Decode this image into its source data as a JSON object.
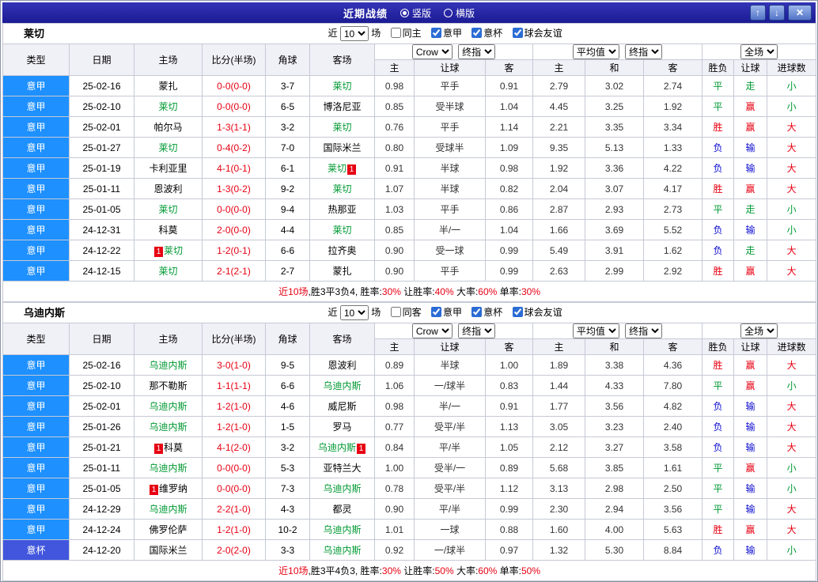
{
  "titlebar": {
    "title": "近期战绩",
    "radios": [
      {
        "label": "竖版",
        "selected": true
      },
      {
        "label": "横版",
        "selected": false
      }
    ],
    "up_icon": "↑",
    "down_icon": "↓",
    "close_icon": "✕"
  },
  "columns": {
    "type": "类型",
    "date": "日期",
    "home": "主场",
    "score": "比分(半场)",
    "corner": "角球",
    "away": "客场",
    "sub": [
      "主",
      "让球",
      "客",
      "主",
      "和",
      "客",
      "胜负",
      "让球",
      "进球数"
    ]
  },
  "selects": {
    "company": "Crow",
    "final": "终指",
    "average": "平均值",
    "scope": "全场"
  },
  "colors": {
    "win": "#e60012",
    "draw": "#009933",
    "lose": "#0b0bd0",
    "focus_team": "#009933",
    "score": "#e60012",
    "serie_a": "#1e90ff",
    "cup": "#4156dd",
    "badge": "#e60012",
    "titlebar_bg": "#1b1b94"
  },
  "badge_text": "1",
  "sections": [
    {
      "team": "莱切",
      "filter": {
        "near": "近",
        "count": "10",
        "unit": "场",
        "same": {
          "label": "同主",
          "checked": false
        },
        "leagues": [
          {
            "label": "意甲",
            "checked": true
          },
          {
            "label": "意杯",
            "checked": true
          },
          {
            "label": "球会友谊",
            "checked": true
          }
        ]
      },
      "rows": [
        {
          "lg": "意甲",
          "lgc": "a",
          "date": "25-02-16",
          "home": {
            "n": "蒙扎"
          },
          "score": "0-0(0-0)",
          "corner": "3-7",
          "away": {
            "n": "莱切",
            "f": 1
          },
          "o": [
            "0.98",
            "平手",
            "0.91"
          ],
          "avg": [
            "2.79",
            "3.02",
            "2.74"
          ],
          "res": [
            "平",
            "g"
          ],
          "hres": [
            "走",
            "g"
          ],
          "gres": [
            "小",
            "g"
          ]
        },
        {
          "lg": "意甲",
          "lgc": "a",
          "date": "25-02-10",
          "home": {
            "n": "莱切",
            "f": 1
          },
          "score": "0-0(0-0)",
          "corner": "6-5",
          "away": {
            "n": "博洛尼亚"
          },
          "o": [
            "0.85",
            "受半球",
            "1.04"
          ],
          "avg": [
            "4.45",
            "3.25",
            "1.92"
          ],
          "res": [
            "平",
            "g"
          ],
          "hres": [
            "赢",
            "r"
          ],
          "gres": [
            "小",
            "g"
          ]
        },
        {
          "lg": "意甲",
          "lgc": "a",
          "date": "25-02-01",
          "home": {
            "n": "帕尔马"
          },
          "score": "1-3(1-1)",
          "corner": "3-2",
          "away": {
            "n": "莱切",
            "f": 1
          },
          "o": [
            "0.76",
            "平手",
            "1.14"
          ],
          "avg": [
            "2.21",
            "3.35",
            "3.34"
          ],
          "res": [
            "胜",
            "r"
          ],
          "hres": [
            "赢",
            "r"
          ],
          "gres": [
            "大",
            "r"
          ]
        },
        {
          "lg": "意甲",
          "lgc": "a",
          "date": "25-01-27",
          "home": {
            "n": "莱切",
            "f": 1
          },
          "score": "0-4(0-2)",
          "corner": "7-0",
          "away": {
            "n": "国际米兰"
          },
          "o": [
            "0.80",
            "受球半",
            "1.09"
          ],
          "avg": [
            "9.35",
            "5.13",
            "1.33"
          ],
          "res": [
            "负",
            "b"
          ],
          "hres": [
            "输",
            "b"
          ],
          "gres": [
            "大",
            "r"
          ]
        },
        {
          "lg": "意甲",
          "lgc": "a",
          "date": "25-01-19",
          "home": {
            "n": "卡利亚里"
          },
          "score": "4-1(0-1)",
          "corner": "6-1",
          "away": {
            "n": "莱切",
            "f": 1,
            "b": "post"
          },
          "o": [
            "0.91",
            "半球",
            "0.98"
          ],
          "avg": [
            "1.92",
            "3.36",
            "4.22"
          ],
          "res": [
            "负",
            "b"
          ],
          "hres": [
            "输",
            "b"
          ],
          "gres": [
            "大",
            "r"
          ]
        },
        {
          "lg": "意甲",
          "lgc": "a",
          "date": "25-01-11",
          "home": {
            "n": "恩波利"
          },
          "score": "1-3(0-2)",
          "corner": "9-2",
          "away": {
            "n": "莱切",
            "f": 1
          },
          "o": [
            "1.07",
            "半球",
            "0.82"
          ],
          "avg": [
            "2.04",
            "3.07",
            "4.17"
          ],
          "res": [
            "胜",
            "r"
          ],
          "hres": [
            "赢",
            "r"
          ],
          "gres": [
            "大",
            "r"
          ]
        },
        {
          "lg": "意甲",
          "lgc": "a",
          "date": "25-01-05",
          "home": {
            "n": "莱切",
            "f": 1
          },
          "score": "0-0(0-0)",
          "corner": "9-4",
          "away": {
            "n": "热那亚"
          },
          "o": [
            "1.03",
            "平手",
            "0.86"
          ],
          "avg": [
            "2.87",
            "2.93",
            "2.73"
          ],
          "res": [
            "平",
            "g"
          ],
          "hres": [
            "走",
            "g"
          ],
          "gres": [
            "小",
            "g"
          ]
        },
        {
          "lg": "意甲",
          "lgc": "a",
          "date": "24-12-31",
          "home": {
            "n": "科莫"
          },
          "score": "2-0(0-0)",
          "corner": "4-4",
          "away": {
            "n": "莱切",
            "f": 1
          },
          "o": [
            "0.85",
            "半/一",
            "1.04"
          ],
          "avg": [
            "1.66",
            "3.69",
            "5.52"
          ],
          "res": [
            "负",
            "b"
          ],
          "hres": [
            "输",
            "b"
          ],
          "gres": [
            "小",
            "g"
          ]
        },
        {
          "lg": "意甲",
          "lgc": "a",
          "date": "24-12-22",
          "home": {
            "n": "莱切",
            "f": 1,
            "b": "pre"
          },
          "score": "1-2(0-1)",
          "corner": "6-6",
          "away": {
            "n": "拉齐奥"
          },
          "o": [
            "0.90",
            "受一球",
            "0.99"
          ],
          "avg": [
            "5.49",
            "3.91",
            "1.62"
          ],
          "res": [
            "负",
            "b"
          ],
          "hres": [
            "走",
            "g"
          ],
          "gres": [
            "大",
            "r"
          ]
        },
        {
          "lg": "意甲",
          "lgc": "a",
          "date": "24-12-15",
          "home": {
            "n": "莱切",
            "f": 1
          },
          "score": "2-1(2-1)",
          "corner": "2-7",
          "away": {
            "n": "蒙扎"
          },
          "o": [
            "0.90",
            "平手",
            "0.99"
          ],
          "avg": [
            "2.63",
            "2.99",
            "2.92"
          ],
          "res": [
            "胜",
            "r"
          ],
          "hres": [
            "赢",
            "r"
          ],
          "gres": [
            "大",
            "r"
          ]
        }
      ],
      "summary": [
        {
          "t": "近10场",
          "c": "r"
        },
        {
          "t": ",胜3平3负4, 胜率:",
          "c": "k"
        },
        {
          "t": "30%",
          "c": "r"
        },
        {
          "t": " 让胜率:",
          "c": "k"
        },
        {
          "t": "40%",
          "c": "r"
        },
        {
          "t": " 大率:",
          "c": "k"
        },
        {
          "t": "60%",
          "c": "r"
        },
        {
          "t": " 单率:",
          "c": "k"
        },
        {
          "t": "30%",
          "c": "r"
        }
      ]
    },
    {
      "team": "乌迪内斯",
      "filter": {
        "near": "近",
        "count": "10",
        "unit": "场",
        "same": {
          "label": "同客",
          "checked": false
        },
        "leagues": [
          {
            "label": "意甲",
            "checked": true
          },
          {
            "label": "意杯",
            "checked": true
          },
          {
            "label": "球会友谊",
            "checked": true
          }
        ]
      },
      "rows": [
        {
          "lg": "意甲",
          "lgc": "a",
          "date": "25-02-16",
          "home": {
            "n": "乌迪内斯",
            "f": 1
          },
          "score": "3-0(1-0)",
          "corner": "9-5",
          "away": {
            "n": "恩波利"
          },
          "o": [
            "0.89",
            "半球",
            "1.00"
          ],
          "avg": [
            "1.89",
            "3.38",
            "4.36"
          ],
          "res": [
            "胜",
            "r"
          ],
          "hres": [
            "赢",
            "r"
          ],
          "gres": [
            "大",
            "r"
          ]
        },
        {
          "lg": "意甲",
          "lgc": "a",
          "date": "25-02-10",
          "home": {
            "n": "那不勒斯"
          },
          "score": "1-1(1-1)",
          "corner": "6-6",
          "away": {
            "n": "乌迪内斯",
            "f": 1
          },
          "o": [
            "1.06",
            "一/球半",
            "0.83"
          ],
          "avg": [
            "1.44",
            "4.33",
            "7.80"
          ],
          "res": [
            "平",
            "g"
          ],
          "hres": [
            "赢",
            "r"
          ],
          "gres": [
            "小",
            "g"
          ]
        },
        {
          "lg": "意甲",
          "lgc": "a",
          "date": "25-02-01",
          "home": {
            "n": "乌迪内斯",
            "f": 1
          },
          "score": "1-2(1-0)",
          "corner": "4-6",
          "away": {
            "n": "威尼斯"
          },
          "o": [
            "0.98",
            "半/一",
            "0.91"
          ],
          "avg": [
            "1.77",
            "3.56",
            "4.82"
          ],
          "res": [
            "负",
            "b"
          ],
          "hres": [
            "输",
            "b"
          ],
          "gres": [
            "大",
            "r"
          ]
        },
        {
          "lg": "意甲",
          "lgc": "a",
          "date": "25-01-26",
          "home": {
            "n": "乌迪内斯",
            "f": 1
          },
          "score": "1-2(1-0)",
          "corner": "1-5",
          "away": {
            "n": "罗马"
          },
          "o": [
            "0.77",
            "受平/半",
            "1.13"
          ],
          "avg": [
            "3.05",
            "3.23",
            "2.40"
          ],
          "res": [
            "负",
            "b"
          ],
          "hres": [
            "输",
            "b"
          ],
          "gres": [
            "大",
            "r"
          ]
        },
        {
          "lg": "意甲",
          "lgc": "a",
          "date": "25-01-21",
          "home": {
            "n": "科莫",
            "b": "pre"
          },
          "score": "4-1(2-0)",
          "corner": "3-2",
          "away": {
            "n": "乌迪内斯",
            "f": 1,
            "b": "post"
          },
          "o": [
            "0.84",
            "平/半",
            "1.05"
          ],
          "avg": [
            "2.12",
            "3.27",
            "3.58"
          ],
          "res": [
            "负",
            "b"
          ],
          "hres": [
            "输",
            "b"
          ],
          "gres": [
            "大",
            "r"
          ]
        },
        {
          "lg": "意甲",
          "lgc": "a",
          "date": "25-01-11",
          "home": {
            "n": "乌迪内斯",
            "f": 1
          },
          "score": "0-0(0-0)",
          "corner": "5-3",
          "away": {
            "n": "亚特兰大"
          },
          "o": [
            "1.00",
            "受半/一",
            "0.89"
          ],
          "avg": [
            "5.68",
            "3.85",
            "1.61"
          ],
          "res": [
            "平",
            "g"
          ],
          "hres": [
            "赢",
            "r"
          ],
          "gres": [
            "小",
            "g"
          ]
        },
        {
          "lg": "意甲",
          "lgc": "a",
          "date": "25-01-05",
          "home": {
            "n": "维罗纳",
            "b": "pre"
          },
          "score": "0-0(0-0)",
          "corner": "7-3",
          "away": {
            "n": "乌迪内斯",
            "f": 1
          },
          "o": [
            "0.78",
            "受平/半",
            "1.12"
          ],
          "avg": [
            "3.13",
            "2.98",
            "2.50"
          ],
          "res": [
            "平",
            "g"
          ],
          "hres": [
            "输",
            "b"
          ],
          "gres": [
            "小",
            "g"
          ]
        },
        {
          "lg": "意甲",
          "lgc": "a",
          "date": "24-12-29",
          "home": {
            "n": "乌迪内斯",
            "f": 1
          },
          "score": "2-2(1-0)",
          "corner": "4-3",
          "away": {
            "n": "都灵"
          },
          "o": [
            "0.90",
            "平/半",
            "0.99"
          ],
          "avg": [
            "2.30",
            "2.94",
            "3.56"
          ],
          "res": [
            "平",
            "g"
          ],
          "hres": [
            "输",
            "b"
          ],
          "gres": [
            "大",
            "r"
          ]
        },
        {
          "lg": "意甲",
          "lgc": "a",
          "date": "24-12-24",
          "home": {
            "n": "佛罗伦萨"
          },
          "score": "1-2(1-0)",
          "corner": "10-2",
          "away": {
            "n": "乌迪内斯",
            "f": 1
          },
          "o": [
            "1.01",
            "一球",
            "0.88"
          ],
          "avg": [
            "1.60",
            "4.00",
            "5.63"
          ],
          "res": [
            "胜",
            "r"
          ],
          "hres": [
            "赢",
            "r"
          ],
          "gres": [
            "大",
            "r"
          ]
        },
        {
          "lg": "意杯",
          "lgc": "c",
          "date": "24-12-20",
          "home": {
            "n": "国际米兰"
          },
          "score": "2-0(2-0)",
          "corner": "3-3",
          "away": {
            "n": "乌迪内斯",
            "f": 1
          },
          "o": [
            "0.92",
            "一/球半",
            "0.97"
          ],
          "avg": [
            "1.32",
            "5.30",
            "8.84"
          ],
          "res": [
            "负",
            "b"
          ],
          "hres": [
            "输",
            "b"
          ],
          "gres": [
            "小",
            "g"
          ]
        }
      ],
      "summary": [
        {
          "t": "近10场",
          "c": "r"
        },
        {
          "t": ",胜3平4负3, 胜率:",
          "c": "k"
        },
        {
          "t": "30%",
          "c": "r"
        },
        {
          "t": " 让胜率:",
          "c": "k"
        },
        {
          "t": "50%",
          "c": "r"
        },
        {
          "t": " 大率:",
          "c": "k"
        },
        {
          "t": "60%",
          "c": "r"
        },
        {
          "t": " 单率:",
          "c": "k"
        },
        {
          "t": "50%",
          "c": "r"
        }
      ]
    }
  ]
}
